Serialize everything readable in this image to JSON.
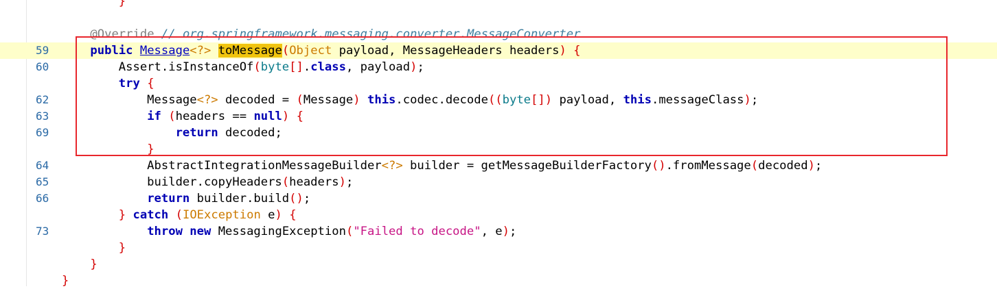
{
  "editor": {
    "lines": [
      {
        "n": "",
        "segs": [
          {
            "t": "        "
          },
          {
            "t": "}",
            "c": "brk"
          }
        ]
      },
      {
        "n": "",
        "segs": []
      },
      {
        "n": "",
        "segs": [
          {
            "t": "    "
          },
          {
            "t": "@Override",
            "c": "ann"
          },
          {
            "t": " "
          },
          {
            "t": "// org.springframework.messaging.converter.MessageConverter",
            "c": "cm"
          }
        ]
      },
      {
        "n": "59",
        "hl": true,
        "segs": [
          {
            "t": "    "
          },
          {
            "t": "public",
            "c": "kw"
          },
          {
            "t": " "
          },
          {
            "t": "Message",
            "c": "link"
          },
          {
            "t": "<?>",
            "c": "par"
          },
          {
            "t": " "
          },
          {
            "t": "toMessage",
            "c": "sel"
          },
          {
            "t": "(",
            "c": "red"
          },
          {
            "t": "Object",
            "c": "par"
          },
          {
            "t": " payload, MessageHeaders headers"
          },
          {
            "t": ")",
            "c": "red"
          },
          {
            "t": " "
          },
          {
            "t": "{",
            "c": "red"
          }
        ]
      },
      {
        "n": "60",
        "segs": [
          {
            "t": "        Assert.isInstanceOf"
          },
          {
            "t": "(",
            "c": "red"
          },
          {
            "t": "byte",
            "c": "ty"
          },
          {
            "t": "[]",
            "c": "red"
          },
          {
            "t": "."
          },
          {
            "t": "class",
            "c": "kw"
          },
          {
            "t": ", payload"
          },
          {
            "t": ")",
            "c": "red"
          },
          {
            "t": ";"
          }
        ]
      },
      {
        "n": "",
        "segs": [
          {
            "t": "        "
          },
          {
            "t": "try",
            "c": "kw"
          },
          {
            "t": " "
          },
          {
            "t": "{",
            "c": "red"
          }
        ]
      },
      {
        "n": "62",
        "segs": [
          {
            "t": "            Message"
          },
          {
            "t": "<?>",
            "c": "par"
          },
          {
            "t": " decoded = "
          },
          {
            "t": "(",
            "c": "red"
          },
          {
            "t": "Message"
          },
          {
            "t": ")",
            "c": "red"
          },
          {
            "t": " "
          },
          {
            "t": "this",
            "c": "kw"
          },
          {
            "t": ".codec.decode"
          },
          {
            "t": "((",
            "c": "red"
          },
          {
            "t": "byte",
            "c": "ty"
          },
          {
            "t": "[])",
            "c": "red"
          },
          {
            "t": " payload, "
          },
          {
            "t": "this",
            "c": "kw"
          },
          {
            "t": ".messageClass"
          },
          {
            "t": ")",
            "c": "red"
          },
          {
            "t": ";"
          }
        ]
      },
      {
        "n": "63",
        "segs": [
          {
            "t": "            "
          },
          {
            "t": "if",
            "c": "kw"
          },
          {
            "t": " "
          },
          {
            "t": "(",
            "c": "red"
          },
          {
            "t": "headers == "
          },
          {
            "t": "null",
            "c": "kw"
          },
          {
            "t": ")",
            "c": "red"
          },
          {
            "t": " "
          },
          {
            "t": "{",
            "c": "red"
          }
        ]
      },
      {
        "n": "69",
        "segs": [
          {
            "t": "                "
          },
          {
            "t": "return",
            "c": "kw"
          },
          {
            "t": " decoded;"
          }
        ]
      },
      {
        "n": "",
        "segs": [
          {
            "t": "            "
          },
          {
            "t": "}",
            "c": "red"
          }
        ]
      },
      {
        "n": "64",
        "segs": [
          {
            "t": "            AbstractIntegrationMessageBuilder"
          },
          {
            "t": "<?>",
            "c": "par"
          },
          {
            "t": " builder = getMessageBuilderFactory"
          },
          {
            "t": "()",
            "c": "red"
          },
          {
            "t": ".fromMessage"
          },
          {
            "t": "(",
            "c": "red"
          },
          {
            "t": "decoded"
          },
          {
            "t": ")",
            "c": "red"
          },
          {
            "t": ";"
          }
        ]
      },
      {
        "n": "65",
        "segs": [
          {
            "t": "            builder.copyHeaders"
          },
          {
            "t": "(",
            "c": "red"
          },
          {
            "t": "headers"
          },
          {
            "t": ")",
            "c": "red"
          },
          {
            "t": ";"
          }
        ]
      },
      {
        "n": "66",
        "segs": [
          {
            "t": "            "
          },
          {
            "t": "return",
            "c": "kw"
          },
          {
            "t": " builder.build"
          },
          {
            "t": "()",
            "c": "red"
          },
          {
            "t": ";"
          }
        ]
      },
      {
        "n": "",
        "segs": [
          {
            "t": "        "
          },
          {
            "t": "}",
            "c": "red"
          },
          {
            "t": " "
          },
          {
            "t": "catch",
            "c": "kw"
          },
          {
            "t": " "
          },
          {
            "t": "(",
            "c": "red"
          },
          {
            "t": "IOException",
            "c": "par"
          },
          {
            "t": " e"
          },
          {
            "t": ")",
            "c": "red"
          },
          {
            "t": " "
          },
          {
            "t": "{",
            "c": "red"
          }
        ]
      },
      {
        "n": "73",
        "segs": [
          {
            "t": "            "
          },
          {
            "t": "throw",
            "c": "kw"
          },
          {
            "t": " "
          },
          {
            "t": "new",
            "c": "kw"
          },
          {
            "t": " MessagingException"
          },
          {
            "t": "(",
            "c": "red"
          },
          {
            "t": "\"Failed to decode\"",
            "c": "str"
          },
          {
            "t": ", e"
          },
          {
            "t": ")",
            "c": "red"
          },
          {
            "t": ";"
          }
        ]
      },
      {
        "n": "",
        "segs": [
          {
            "t": "        "
          },
          {
            "t": "}",
            "c": "red"
          }
        ]
      },
      {
        "n": "",
        "segs": [
          {
            "t": "    "
          },
          {
            "t": "}",
            "c": "red"
          }
        ]
      },
      {
        "n": "",
        "segs": [
          {
            "t": "}",
            "c": "red"
          }
        ]
      }
    ]
  }
}
